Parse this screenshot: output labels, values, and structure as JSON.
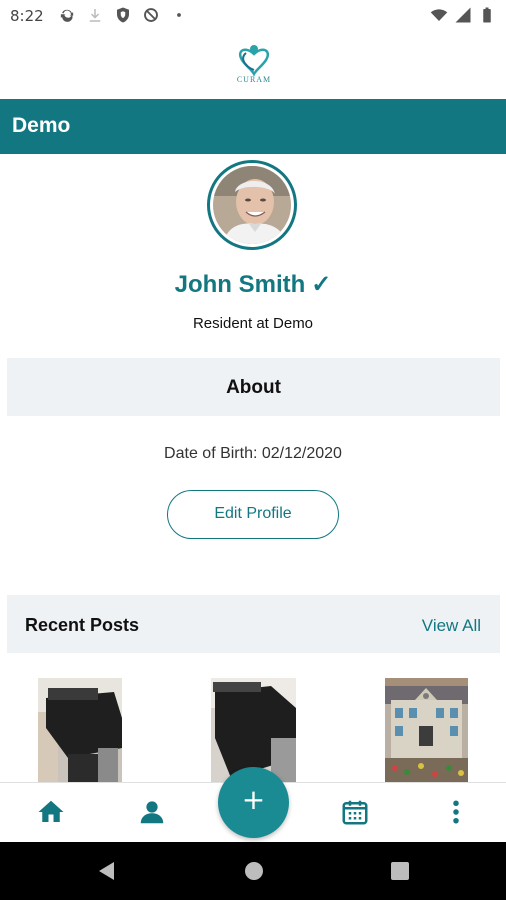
{
  "status_bar": {
    "time": "8:22",
    "icons": [
      "sync-icon",
      "download-icon",
      "shield-icon",
      "no-disturb-icon",
      "dot-icon",
      "wifi-icon",
      "signal-icon",
      "battery-icon"
    ]
  },
  "app": {
    "logo_text": "CURAM",
    "title": "Demo"
  },
  "profile": {
    "name": "John Smith",
    "verified_mark": "✓",
    "subtitle": "Resident at Demo"
  },
  "about": {
    "title": "About",
    "dob": "Date of Birth: 02/12/2020",
    "edit_label": "Edit Profile"
  },
  "recent_posts": {
    "title": "Recent Posts",
    "view_all": "View All",
    "thumbnails": [
      "desk-photo",
      "desk-photo",
      "building-artwork"
    ]
  },
  "bottom_nav": {
    "items": [
      "home-icon",
      "profile-icon",
      "add-icon",
      "calendar-icon",
      "more-icon"
    ],
    "fab_label": "+"
  },
  "colors": {
    "primary": "#137782",
    "section_bg": "#eef2f5"
  }
}
